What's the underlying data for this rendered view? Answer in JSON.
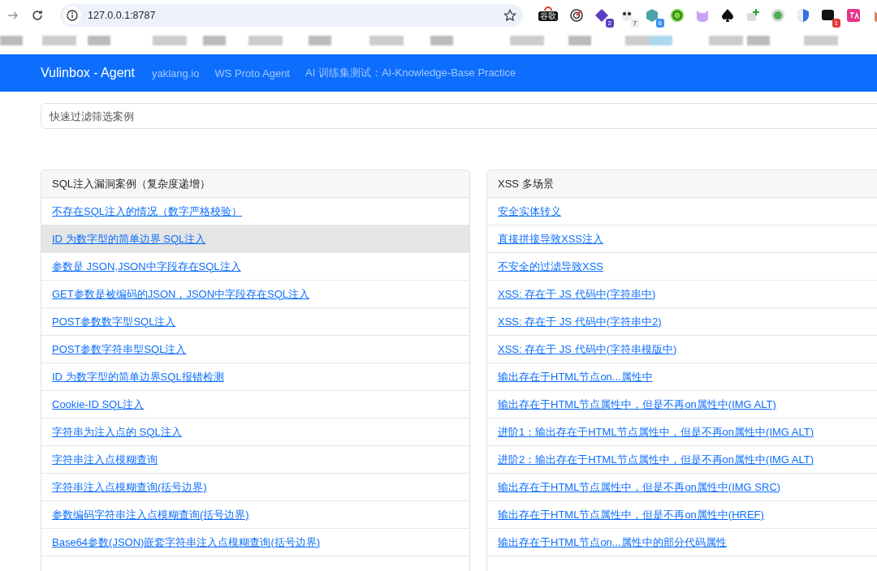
{
  "browser": {
    "url": "127.0.0.1:8787",
    "extensions": [
      {
        "kind": "label",
        "badge": "谷歌"
      },
      {
        "kind": "target"
      },
      {
        "kind": "diamond",
        "badge": "2"
      },
      {
        "kind": "panda",
        "badge": "7"
      },
      {
        "kind": "cube",
        "badge": "6"
      },
      {
        "kind": "ring"
      },
      {
        "kind": "mascot"
      },
      {
        "kind": "spade"
      },
      {
        "kind": "plus"
      },
      {
        "kind": "dot"
      },
      {
        "kind": "shield"
      },
      {
        "kind": "window",
        "badge": "1"
      },
      {
        "kind": "translate"
      },
      {
        "kind": "owl"
      }
    ]
  },
  "navbar": {
    "brand": "Vulinbox - Agent",
    "links": [
      "yaklang.io",
      "WS Proto Agent",
      "AI 训练集测试：AI-Knowledge-Base Practice"
    ]
  },
  "filter": {
    "placeholder": "快速过滤筛选案例"
  },
  "cards": [
    {
      "title": "SQL注入漏洞案例（复杂度递增）",
      "items": [
        {
          "label": "不存在SQL注入的情况（数字严格校验）",
          "selected": false
        },
        {
          "label": "ID 为数字型的简单边界 SQL注入",
          "selected": true
        },
        {
          "label": "参数是 JSON,JSON中字段存在SQL注入",
          "selected": false
        },
        {
          "label": "GET参数是被编码的JSON，JSON中字段存在SQL注入",
          "selected": false
        },
        {
          "label": "POST参数数字型SQL注入",
          "selected": false
        },
        {
          "label": "POST参数字符串型SQL注入",
          "selected": false
        },
        {
          "label": "ID 为数字型的简单边界SQL报错检测",
          "selected": false
        },
        {
          "label": "Cookie-ID SQL注入",
          "selected": false
        },
        {
          "label": "字符串为注入点的 SQL注入",
          "selected": false
        },
        {
          "label": "字符串注入点模糊查询",
          "selected": false
        },
        {
          "label": "字符串注入点模糊查询(括号边界)",
          "selected": false
        },
        {
          "label": "参数编码字符串注入点模糊查询(括号边界)",
          "selected": false
        },
        {
          "label": "Base64参数(JSON)嵌套字符串注入点模糊查询(括号边界)",
          "selected": false
        }
      ]
    },
    {
      "title": "XSS 多场景",
      "items": [
        {
          "label": "安全实体转义",
          "selected": false
        },
        {
          "label": "直接拼接导致XSS注入",
          "selected": false
        },
        {
          "label": "不安全的过滤导致XSS",
          "selected": false
        },
        {
          "label": "XSS: 存在于 JS 代码中(字符串中)",
          "selected": false
        },
        {
          "label": "XSS: 存在于 JS 代码中(字符串中2)",
          "selected": false
        },
        {
          "label": "XSS: 存在于 JS 代码中(字符串模版中)",
          "selected": false
        },
        {
          "label": "输出存在于HTML节点on...属性中",
          "selected": false
        },
        {
          "label": "输出存在于HTML节点属性中，但是不再on属性中(IMG ALT)",
          "selected": false
        },
        {
          "label": "进阶1：输出存在于HTML节点属性中，但是不再on属性中(IMG ALT)",
          "selected": false
        },
        {
          "label": "进阶2：输出存在于HTML节点属性中，但是不再on属性中(IMG ALT)",
          "selected": false
        },
        {
          "label": "输出存在于HTML节点属性中，但是不再on属性中(IMG SRC)",
          "selected": false
        },
        {
          "label": "输出存在于HTML节点属性中，但是不再on属性中(HREF)",
          "selected": false
        },
        {
          "label": "输出存在于HTML节点on...属性中的部分代码属性",
          "selected": false
        }
      ]
    }
  ]
}
